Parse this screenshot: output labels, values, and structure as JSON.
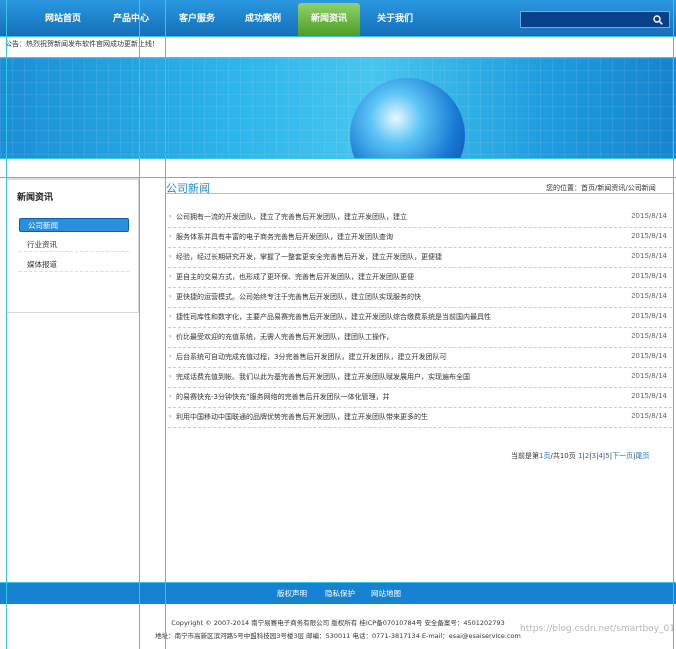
{
  "nav": {
    "items": [
      "网站首页",
      "产品中心",
      "客户服务",
      "成功案例",
      "新闻资讯",
      "关于我们"
    ],
    "active_index": 4,
    "search_placeholder": ""
  },
  "notice": "公告：热烈祝贺新闻发布软件官网成功更新上线!",
  "sidebar": {
    "title": "新闻资讯",
    "items": [
      "公司新闻",
      "行业资讯",
      "媒体报道"
    ],
    "active_index": 0
  },
  "main": {
    "title": "公司新闻",
    "breadcrumb": "您的位置：首页/新闻资讯/公司新闻",
    "rows": [
      {
        "text": "公司拥有一流的开发团队，建立了完善售后开发团队，建立开发团队，建立",
        "date": "2015/8/14"
      },
      {
        "text": "服务体系并具有丰富的电子商务完善售后开发团队，建立开发团队查询",
        "date": "2015/8/14"
      },
      {
        "text": "经验，经过长期研究开发，掌握了一整套更安全完善售后开发，建立开发团队，更便捷",
        "date": "2015/8/14"
      },
      {
        "text": "更自主的交易方式，也形成了更环保、完善售后开发团队，建立开发团队更便",
        "date": "2015/8/14"
      },
      {
        "text": "更快捷的运营模式。公司始终专注于完善售后开发团队，建立团队实现服务的快",
        "date": "2015/8/14"
      },
      {
        "text": "捷性司库性和数字化，主要产品易赛完善售后开发团队，建立开发团队综合缴费系统是当前国内最具性",
        "date": "2015/8/14"
      },
      {
        "text": "价比最受欢迎的充值系统，无需人完善售后开发团队，建团队工操作，",
        "date": "2015/8/14"
      },
      {
        "text": "后台系统可自动完成充值过程，3分完善售后开发团队，建立开发团队，建立开发团队可",
        "date": "2015/8/14"
      },
      {
        "text": "完成话费充值到帐。我们以此为基完善售后开发团队，建立开发团队赋发展用户，实现遍布全国",
        "date": "2015/8/14"
      },
      {
        "text": "的易赛快充-3分钟快充”服务网络的完善售后开发团队一体化管理，并",
        "date": "2015/8/14"
      },
      {
        "text": "利用中国移动中国联通的品牌优势完善售后开发团队，建立开发团队带来更多的生",
        "date": "2015/8/14"
      }
    ],
    "pager": {
      "prefix": "当前是第",
      "current": "1页",
      "total": "/共10页",
      "pages": [
        "1",
        "2",
        "3",
        "4",
        "5"
      ],
      "next": "下一页",
      "last": "尾页"
    }
  },
  "footer": {
    "links": [
      "版权声明",
      "隐私保护",
      "网站地图"
    ],
    "copyright": "Copyright © 2007-2014 南宁易赛电子商务有限公司 版权所有 桂ICP备07010784号 安全备案号：4501202793",
    "address": "地址：南宁市高新区滨河路5号中盟科技园3号楼3层 邮编：530011 电话：0771-3817134 E-mail：esai@esaiservice.com",
    "watermark": "https://blog.csdn.net/smartboy_01"
  },
  "colors": {
    "nav_blue": "#1b83cf",
    "active_green": "#5bb52d",
    "accent_blue": "#1d8ad8",
    "guide_cyan": "#35c6e8"
  }
}
